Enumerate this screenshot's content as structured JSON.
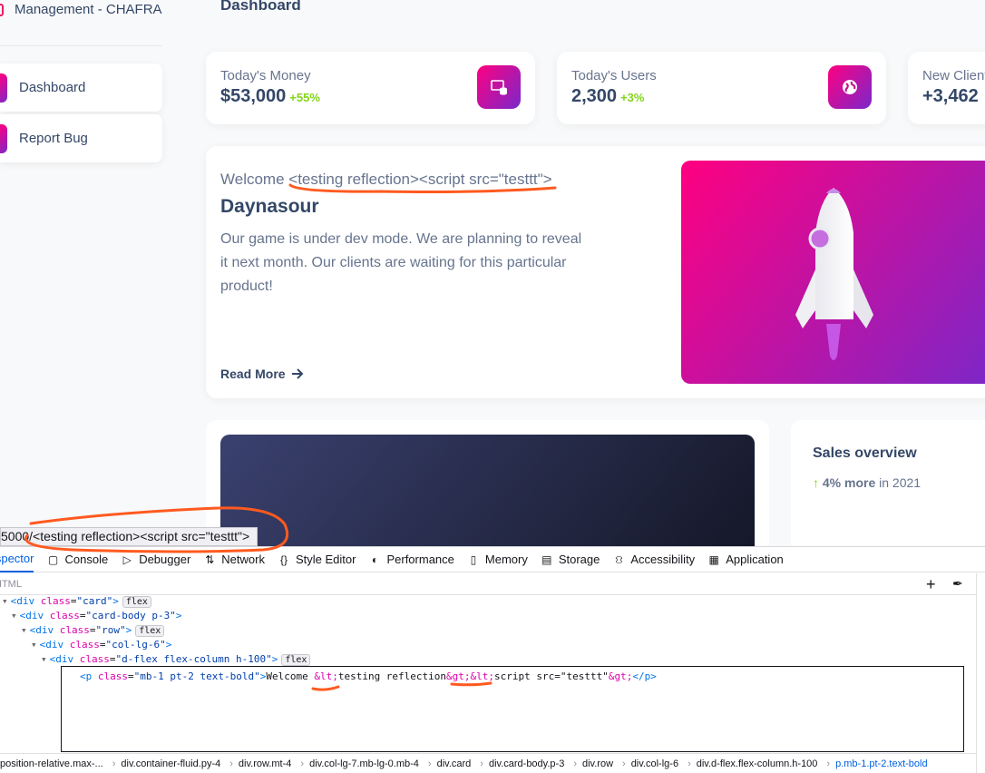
{
  "sidebar": {
    "brand": "Management - CHAFRA",
    "items": [
      {
        "label": "Dashboard"
      },
      {
        "label": "Report Bug"
      }
    ]
  },
  "header": {
    "title": "Dashboard"
  },
  "stats": [
    {
      "label": "Today's Money",
      "value": "$53,000",
      "change": "+55%"
    },
    {
      "label": "Today's Users",
      "value": "2,300",
      "change": "+3%"
    },
    {
      "label": "New Clients",
      "value": "+3,462"
    }
  ],
  "welcome": {
    "text": "Welcome <testing reflection><script src=\"testtt\">",
    "name": "Daynasour",
    "description": "Our game is under dev mode. We are planning to reveal it next month. Our clients are waiting for this particular product!",
    "read_more": "Read More"
  },
  "sales": {
    "title": "Sales overview",
    "change": "4% more",
    "period": "in 2021"
  },
  "url_tooltip": "5000/<testing reflection><script src=\"testtt\">",
  "devtools": {
    "tabs": [
      "Inspector",
      "Console",
      "Debugger",
      "Network",
      "Style Editor",
      "Performance",
      "Memory",
      "Storage",
      "Accessibility",
      "Application"
    ],
    "panel_label": "HTML",
    "badge_flex": "flex",
    "tree": [
      {
        "tag": "div",
        "cls": "card"
      },
      {
        "tag": "div",
        "cls": "card-body p-3"
      },
      {
        "tag": "div",
        "cls": "row"
      },
      {
        "tag": "div",
        "cls": "col-lg-6"
      },
      {
        "tag": "div",
        "cls": "d-flex flex-column h-100"
      }
    ],
    "edit_line": {
      "open": "<p",
      "attr": "class",
      "cls": "mb-1 pt-2 text-bold",
      "text1": "Welcome ",
      "ent1": "&lt;",
      "text2": "testing reflection",
      "ent2": "&gt;&lt;",
      "text3": "script src=\"testtt\"",
      "ent3": "&gt;",
      "close": "</p>"
    },
    "breadcrumbs": [
      "position-relative.max-...",
      "div.container-fluid.py-4",
      "div.row.mt-4",
      "div.col-lg-7.mb-lg-0.mb-4",
      "div.card",
      "div.card-body.p-3",
      "div.row",
      "div.col-lg-6",
      "div.d-flex.flex-column.h-100",
      "p.mb-1.pt-2.text-bold"
    ]
  },
  "colors": {
    "accent_gradient_start": "#7928ca",
    "accent_gradient_end": "#ff0080",
    "positive": "#82d616",
    "annotation": "#ff5a1f"
  },
  "icons": [
    "database-icon",
    "globe-icon",
    "arrow-right-icon",
    "arrow-up-icon",
    "rocket-illustration"
  ]
}
